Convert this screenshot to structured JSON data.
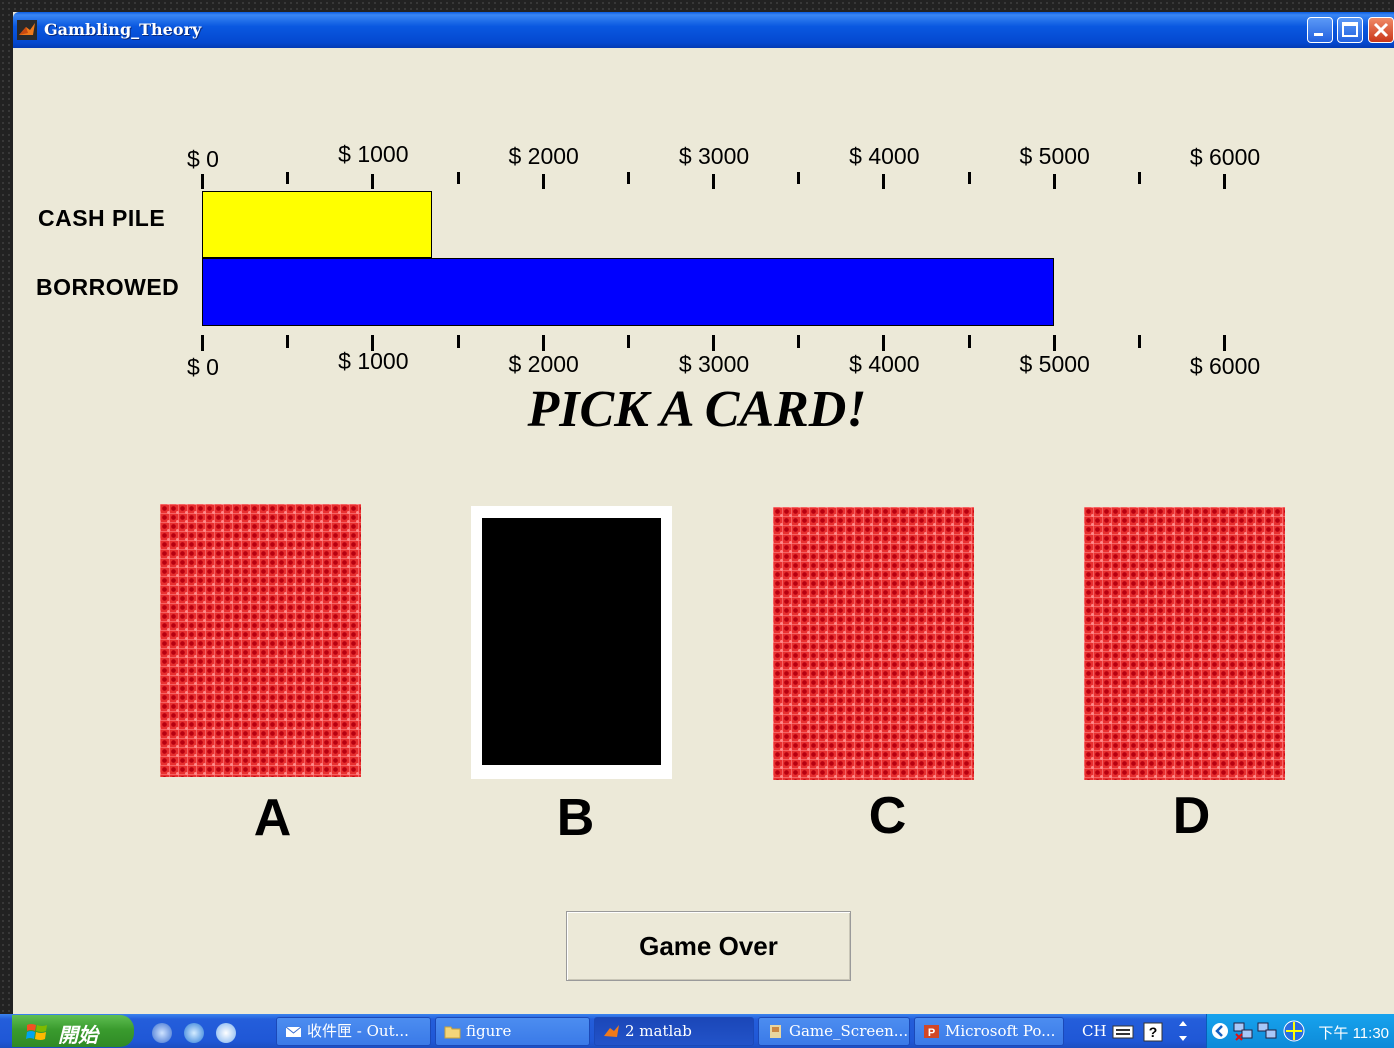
{
  "window": {
    "title": "Gambling_Theory"
  },
  "cash_axis": {
    "top_ticks": [
      "$ 0",
      "$ 1000",
      "$ 2000",
      "$ 3000",
      "$ 4000",
      "$ 5000",
      "$ 6000"
    ],
    "bottom_ticks": [
      "$ 0",
      "$ 1000",
      "$ 2000",
      "$ 3000",
      "$ 4000",
      "$ 5000",
      "$ 6000"
    ]
  },
  "chart_data": {
    "type": "bar",
    "orientation": "horizontal",
    "categories": [
      "CASH  PILE",
      "BORROWED"
    ],
    "values": [
      1350,
      5000
    ],
    "colors": [
      "#ffff00",
      "#0000ff"
    ],
    "xlim": [
      0,
      6000
    ]
  },
  "labels": {
    "cash_pile": "CASH  PILE",
    "borrowed": "BORROWED",
    "prompt": "PICK A CARD!"
  },
  "cards": [
    {
      "letter": "A",
      "state": "face-down"
    },
    {
      "letter": "B",
      "state": "face-up-black"
    },
    {
      "letter": "C",
      "state": "face-down"
    },
    {
      "letter": "D",
      "state": "face-down"
    }
  ],
  "buttons": {
    "game_over": "Game Over"
  },
  "taskbar": {
    "start": "開始",
    "tasks": [
      "收件匣 - Out...",
      "figure",
      "2 matlab",
      "Game_Screen...",
      "Microsoft Po..."
    ],
    "language": "CH",
    "clock": "下午 11:30"
  }
}
